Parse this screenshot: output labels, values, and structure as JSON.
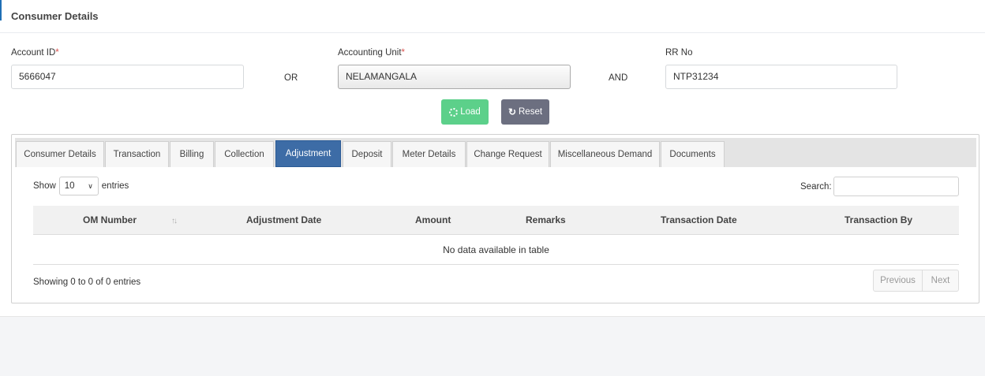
{
  "header": {
    "title": "Consumer Details"
  },
  "form": {
    "account_id": {
      "label": "Account ID",
      "required": "*",
      "value": "5666047"
    },
    "or_text": "OR",
    "accounting_unit": {
      "label": "Accounting Unit",
      "required": "*",
      "value": "NELAMANGALA"
    },
    "and_text": "AND",
    "rr_no": {
      "label": "RR No",
      "value": "NTP31234"
    }
  },
  "buttons": {
    "load": "Load",
    "reset": "Reset"
  },
  "tabs": [
    "Consumer Details",
    "Transaction",
    "Billing",
    "Collection",
    "Adjustment",
    "Deposit",
    "Meter Details",
    "Change Request",
    "Miscellaneous Demand",
    "Documents"
  ],
  "active_tab": "Adjustment",
  "table": {
    "show_label": "Show",
    "page_size": "10",
    "entries_label": "entries",
    "search_label": "Search:",
    "columns": [
      "OM Number",
      "Adjustment Date",
      "Amount",
      "Remarks",
      "Transaction Date",
      "Transaction By"
    ],
    "empty_message": "No data available in table",
    "info": "Showing 0 to 0 of 0 entries",
    "previous": "Previous",
    "next": "Next"
  },
  "colors": {
    "load": "#5cd08a",
    "reset": "#6c6f80",
    "active_tab": "#3d6ca6",
    "required": "#d9534f"
  },
  "icons": {
    "load": "spinner-icon",
    "reset": "refresh-icon",
    "sort": "sort-icon",
    "dropdown": "chevron-down-icon"
  }
}
